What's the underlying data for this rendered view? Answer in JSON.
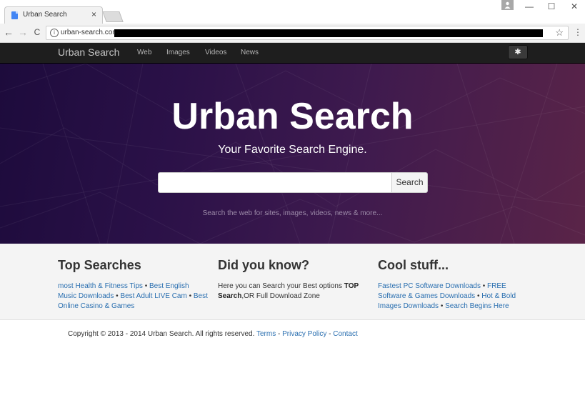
{
  "browser": {
    "tab_title": "Urban Search",
    "tab_close": "×",
    "url": "urban-search.com",
    "window_controls": {
      "minimize": "—",
      "maximize": "☐",
      "close": "✕"
    },
    "nav": {
      "back": "←",
      "forward": "→",
      "reload": "C"
    },
    "star": "☆",
    "menu": "⋮"
  },
  "navbar": {
    "brand": "Urban Search",
    "links": [
      "Web",
      "Images",
      "Videos",
      "News"
    ],
    "settings_glyph": "✱"
  },
  "hero": {
    "title": "Urban Search",
    "tagline": "Your Favorite Search Engine.",
    "search_button": "Search",
    "search_value": "",
    "hint": "Search the web for sites, images, videos, news & more..."
  },
  "sections": {
    "top_searches": {
      "heading": "Top Searches",
      "links": [
        "most Health & Fitness Tips",
        "Best English Music Downloads",
        "Best Adult LIVE Cam",
        "Best Online Casino & Games"
      ],
      "separator": " • "
    },
    "did_you_know": {
      "heading": "Did you know?",
      "text_before": "Here you can Search your Best options ",
      "bold": "TOP Search",
      "text_after": ",OR Full Download Zone"
    },
    "cool_stuff": {
      "heading": "Cool stuff...",
      "links": [
        "Fastest PC Software Downloads",
        "FREE Software & Games Downloads",
        "Hot & Bold Images Downloads",
        "Search Begins Here"
      ],
      "separator": " • "
    }
  },
  "footer": {
    "copyright": "Copyright © 2013 - 2014 Urban Search. All rights reserved. ",
    "links": [
      "Terms",
      "Privacy Policy",
      "Contact"
    ],
    "separator": " - "
  }
}
